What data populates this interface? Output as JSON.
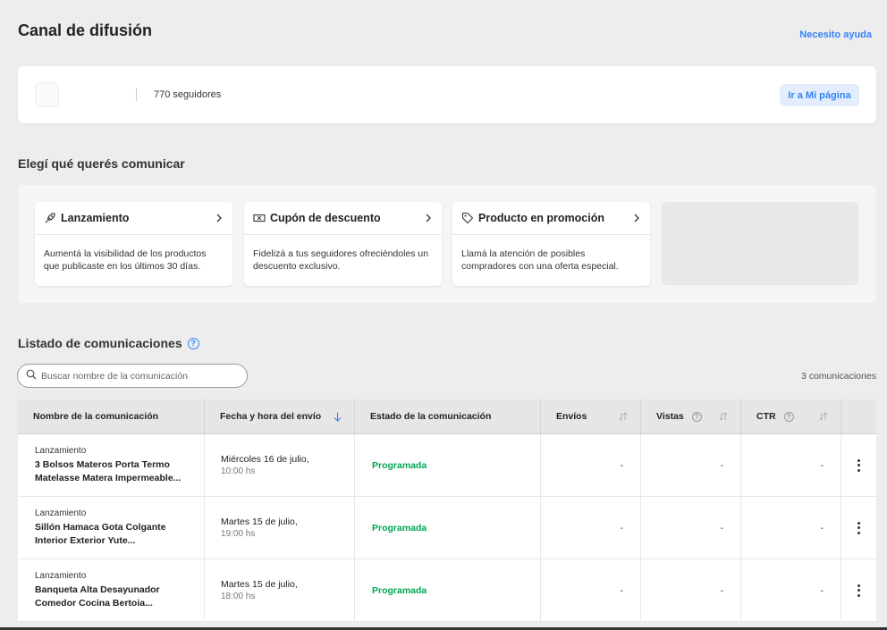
{
  "header": {
    "title": "Canal de difusión",
    "help_link": "Necesito ayuda"
  },
  "profile": {
    "followers": "770 seguidores",
    "my_page_button": "Ir a Mi página"
  },
  "communicate": {
    "title": "Elegí qué querés comunicar",
    "options": [
      {
        "title": "Lanzamiento",
        "icon": "rocket-icon",
        "description": "Aumentá la visibilidad de los productos que publicaste en los últimos 30 días."
      },
      {
        "title": "Cupón de descuento",
        "icon": "coupon-icon",
        "description": "Fidelizá a tus seguidores ofreciéndoles un descuento exclusivo."
      },
      {
        "title": "Producto en promoción",
        "icon": "tag-icon",
        "description": "Llamá la atención de posibles compradores con una oferta especial."
      }
    ]
  },
  "list": {
    "title": "Listado de comunicaciones",
    "search_placeholder": "Buscar nombre de la comunicación",
    "count": "3 comunicaciones",
    "columns": {
      "name": "Nombre de la comunicación",
      "date": "Fecha y hora del envío",
      "status": "Estado de la comunicación",
      "sends": "Envíos",
      "views": "Vistas",
      "ctr": "CTR"
    },
    "rows": [
      {
        "type": "Lanzamiento",
        "name": "3 Bolsos Materos Porta Termo Matelasse Matera Impermeable...",
        "date": "Miércoles 16 de julio,",
        "time": "10:00 hs",
        "status": "Programada",
        "sends": "-",
        "views": "-",
        "ctr": "-"
      },
      {
        "type": "Lanzamiento",
        "name": "Sillón Hamaca Gota Colgante Interior Exterior Yute...",
        "date": "Martes 15 de julio,",
        "time": "19:00 hs",
        "status": "Programada",
        "sends": "-",
        "views": "-",
        "ctr": "-"
      },
      {
        "type": "Lanzamiento",
        "name": "Banqueta Alta Desayunador Comedor Cocina Bertoia...",
        "date": "Martes 15 de julio,",
        "time": "18:00 hs",
        "status": "Programada",
        "sends": "-",
        "views": "-",
        "ctr": "-"
      }
    ]
  },
  "colors": {
    "accent": "#3483fa",
    "status_scheduled": "#00a650",
    "background": "#ededed"
  }
}
